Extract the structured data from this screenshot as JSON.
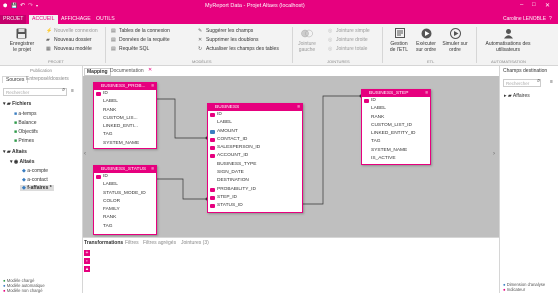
{
  "titlebar": {
    "app_name": "PROJET",
    "window_title": "MyReport Data - Projet Altaes (localhost)",
    "user": "Caroline LENOBLE"
  },
  "tabs": [
    {
      "label": "ACCUEIL"
    },
    {
      "label": "AFFICHAGE"
    },
    {
      "label": "OUTILS"
    }
  ],
  "ribbon": {
    "projet": {
      "save": "Enregistrer le projet",
      "new_connection": "Nouvelle connexion",
      "new_folder": "Nouveau dossier",
      "new_model": "Nouveau modèle",
      "section": "PROJET"
    },
    "modeles": {
      "conn_tables": "Tables de la connexion",
      "query_data": "Données de la requête",
      "sql_query": "Requête SQL",
      "suggest_fields": "Suggérer les champs",
      "remove_duplicates": "Supprimer les doublons",
      "update_fields": "Actualiser les champs des tables",
      "section": "MODÈLES"
    },
    "jointures": {
      "left_join": "Jointure gauche",
      "simple_join": "Jointure simple",
      "right_join": "Jointure droite",
      "full_join": "Jointure totale",
      "section": "JOINTURES"
    },
    "etl": {
      "manage": "Gestion de l'ETL",
      "run": "Exécuter sur ordre",
      "simulate": "Simuler sur ordre",
      "section": "ETL"
    },
    "automatisation": {
      "users": "Automatisations des utilisateurs",
      "section": "AUTOMATISATION"
    }
  },
  "left": {
    "publication": "Publication",
    "tabs": [
      {
        "label": "Sources"
      },
      {
        "label": "Entreposé/dossiers"
      }
    ],
    "search_placeholder": "Rechercher",
    "tree": [
      {
        "label": "Fichiers"
      },
      {
        "label": "a-temps"
      },
      {
        "label": "Balance"
      },
      {
        "label": "Objectifs"
      },
      {
        "label": "Primes"
      },
      {
        "label": "Altaès"
      },
      {
        "label": "Altaès"
      },
      {
        "label": "a-compte"
      },
      {
        "label": "a-contact"
      },
      {
        "label": "f-affaires *"
      }
    ]
  },
  "canvas_tabs": [
    {
      "label": "Mapping"
    },
    {
      "label": "Documentation"
    }
  ],
  "tables": {
    "t1": {
      "name": "BUSINESS_PROB...",
      "fields": [
        "ID",
        "LABEL",
        "RANK",
        "CUSTOM_LIS...",
        "LINKED_ENTI...",
        "TAG",
        "SYSTEM_NAME"
      ]
    },
    "t2": {
      "name": "BUSINESS_STATUS",
      "fields": [
        "ID",
        "LABEL",
        "STATUS_MODE_ID",
        "COLOR",
        "FAMILY",
        "RANK",
        "TAG"
      ]
    },
    "t3": {
      "name": "BUSINESS",
      "fields": [
        "ID",
        "LABEL",
        "AMOUNT",
        "CONTACT_ID",
        "SALESPERSON_ID",
        "ACCOUNT_ID",
        "BUSINESS_TYPE",
        "SIGN_DATE",
        "DESTINATION",
        "PROBABILITY_ID",
        "STEP_ID",
        "STATUS_ID"
      ]
    },
    "t4": {
      "name": "BUSINESS_STEP",
      "fields": [
        "ID",
        "LABEL",
        "RANK",
        "CUSTOM_LIST_ID",
        "LINKED_ENTITY_ID",
        "TAG",
        "SYSTEM_NAME",
        "IS_ACTIVE"
      ]
    }
  },
  "bottom": {
    "tabs": [
      {
        "label": "Transformations"
      },
      {
        "label": "Filtres"
      },
      {
        "label": "Filtres agrégés"
      },
      {
        "label": "Jointures (3)"
      }
    ]
  },
  "right": {
    "title": "Champs destination",
    "search_placeholder": "Rechercher",
    "item": "Affaires"
  },
  "legend_left": [
    {
      "label": "Modèle chargé"
    },
    {
      "label": "Modèle automatique"
    },
    {
      "label": "Modèle non chargé"
    }
  ],
  "legend_right": [
    {
      "label": "Dimension d'analyse"
    },
    {
      "label": "Indicateur"
    }
  ],
  "colors": {
    "brand": "#e6007e",
    "canvas": "#bfbfbf"
  }
}
